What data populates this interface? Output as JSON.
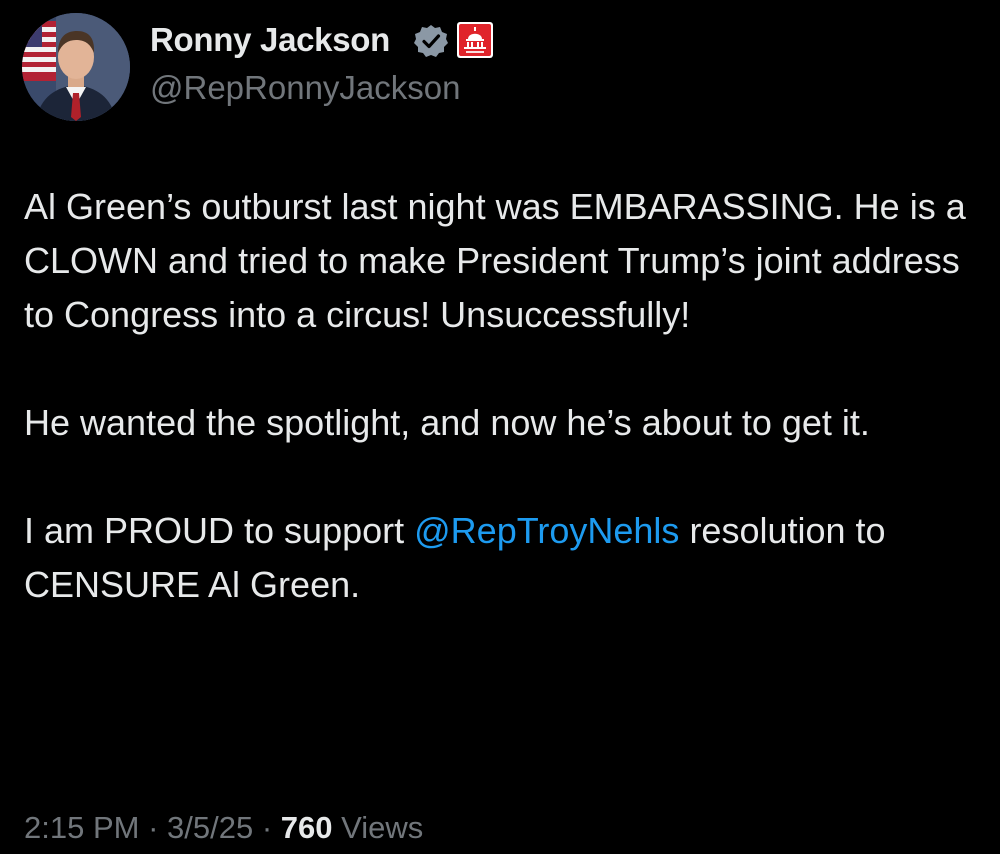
{
  "author": {
    "name": "Ronny Jackson",
    "handle": "@RepRonnyJackson",
    "avatar_icon": "profile-photo-icon",
    "verified_icon": "verified-badge-icon",
    "affiliation_icon": "capitol-gop-badge-icon"
  },
  "tweet": {
    "p1_text": "Al Green’s outburst last night was EMBARASSING. He is a CLOWN and tried to make President Trump’s joint address to Congress into a circus! Unsuccessfully!",
    "p2_text": "He wanted the spotlight, and now he’s about to get it.",
    "p3_before": "I am PROUD to support ",
    "p3_mention": "@RepTroyNehls",
    "p3_after": " resolution to CENSURE Al Green."
  },
  "meta": {
    "time": "2:15 PM",
    "separator": " · ",
    "date": "3/5/25",
    "views_count": "760",
    "views_label": " Views"
  },
  "colors": {
    "background": "#000000",
    "text": "#e7e9ea",
    "secondary": "#71767b",
    "link": "#1d9bf0",
    "affiliation_red": "#e0242b",
    "verified_badge": "#8b98a5"
  }
}
